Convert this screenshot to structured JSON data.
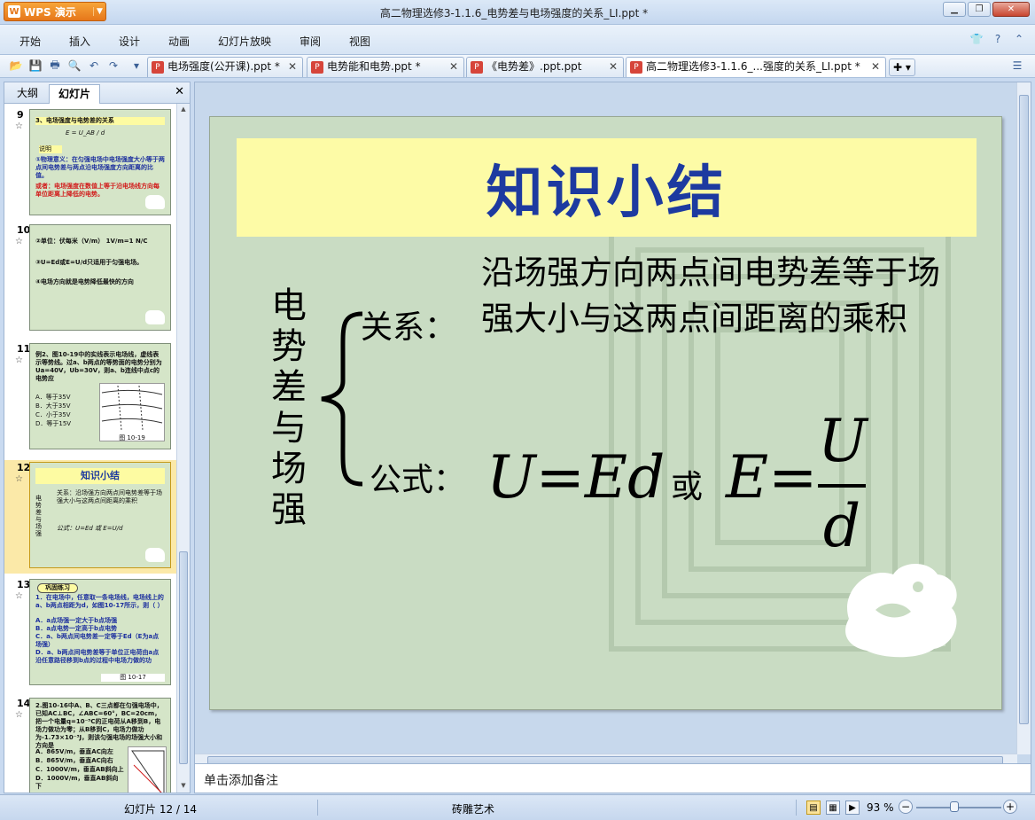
{
  "app": {
    "name": "WPS 演示",
    "logo_letter": "W"
  },
  "window": {
    "title": "高二物理选修3-1.1.6_电势差与电场强度的关系_LI.ppt *"
  },
  "menu": [
    "开始",
    "插入",
    "设计",
    "动画",
    "幻灯片放映",
    "审阅",
    "视图"
  ],
  "doc_tabs": [
    {
      "label": "电场强度(公开课).ppt *",
      "active": false
    },
    {
      "label": "电势能和电势.ppt *",
      "active": false
    },
    {
      "label": "《电势差》.ppt.ppt",
      "active": false
    },
    {
      "label": "高二物理选修3-1.1.6_...强度的关系_LI.ppt *",
      "active": true
    }
  ],
  "left_pane": {
    "tabs": [
      "大纲",
      "幻灯片"
    ],
    "active_tab": "幻灯片",
    "thumbnails": [
      {
        "num": "9",
        "lines": [
          "3、电场强度与电势差的关系",
          "E = U_AB / d",
          "说明",
          "①物理意义：在匀强电场中电场强度大小等于两点间电势差与两点沿电场强度方向距离的比值。",
          "或者：电场强度在数值上等于沿电场线方向每单位距离上降低的电势。"
        ]
      },
      {
        "num": "10",
        "lines": [
          "②单位：伏每米（V/m） 1V/m=1 N/C",
          "③U=Ed或E=U/d只适用于匀强电场。",
          "④电场方向就是电势降低最快的方向"
        ]
      },
      {
        "num": "11",
        "lines": [
          "例2、图10-19中的实线表示电场线，虚线表示等势线。过a、b两点的等势面的电势分别为Ua=40V，Ub=30V，则a、b连线中点c的电势应",
          "A．等于35V",
          "B．大于35V",
          "C．小于35V",
          "D．等于15V",
          "图 10-19"
        ]
      },
      {
        "num": "12",
        "lines": [
          "知识小结",
          "电势差与场强",
          "关系：沿场强方向两点间电势差等于场强大小与这两点间距离的乘积",
          "公式：U=Ed 或 E=U/d"
        ],
        "selected": true
      },
      {
        "num": "13",
        "lines": [
          "巩固练习",
          "1．在电场中，任意取一条电场线，电场线上的a、b两点相距为d，如图10-17所示，则（ ）",
          "A．a点场强一定大于b点场强",
          "B．a点电势一定高于b点电势",
          "C．a、b两点间电势差一定等于Ed（E为a点场强）",
          "D．a、b两点间电势差等于单位正电荷由a点沿任意路径移到b点的过程中电场力做的功",
          "图 10-17"
        ]
      },
      {
        "num": "14",
        "lines": [
          "2.图10-16中A、B、C三点都在匀强电场中，已知AC⊥BC，∠ABC=60°，BC=20cm，把一个电量q=10⁻⁵C的正电荷从A移到B，电场力做功为零；从B移到C，电场力做功为-1.73×10⁻³J，则该匀强电场的场强大小和方向是",
          "A．865V/m，垂直AC向左",
          "B．865V/m，垂直AC向右",
          "C．1000V/m，垂直AB斜向上",
          "D．1000V/m，垂直AB斜向下"
        ]
      }
    ]
  },
  "slide": {
    "title": "知识小结",
    "vertical_label": [
      "电",
      "势",
      "差",
      "与",
      "场",
      "强"
    ],
    "relation_label": "关系：",
    "relation_text": "沿场强方向两点间电势差等于场强大小与这两点间距离的乘积",
    "formula_label": "公式：",
    "formula_1": "U=Ed",
    "formula_or": "或",
    "formula_2": "E=",
    "frac_num": "U",
    "frac_den": "d",
    "colors": {
      "background": "#c9dcc3",
      "title_bar": "#fdfba6",
      "title_text": "#1d3aa0"
    }
  },
  "notes": {
    "placeholder": "单击添加备注"
  },
  "status": {
    "slide_indicator": "幻灯片 12 / 14",
    "theme": "砖雕艺术",
    "zoom": "93 %"
  }
}
